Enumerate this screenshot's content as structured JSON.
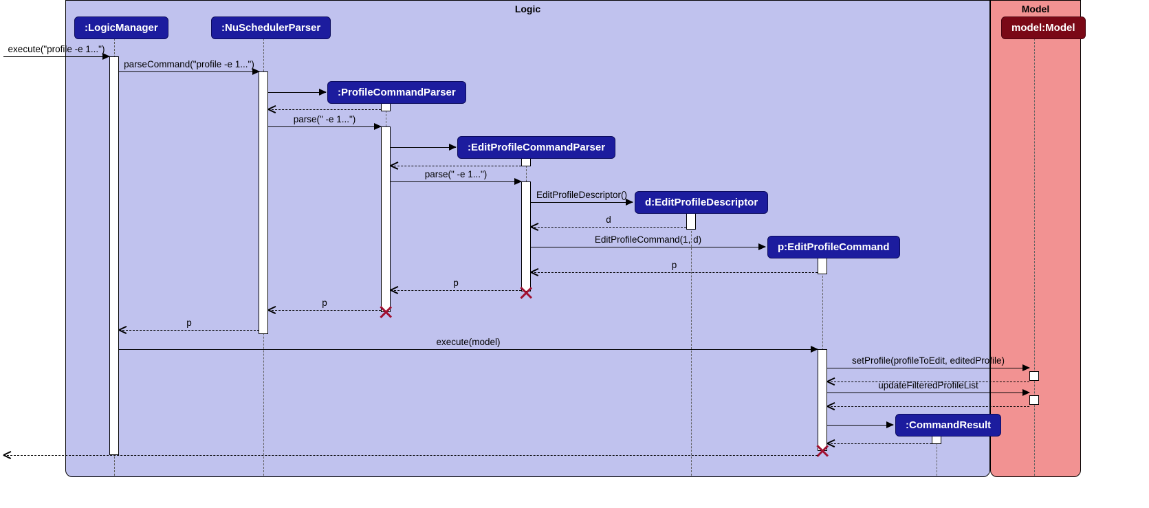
{
  "frames": {
    "logic": "Logic",
    "model": "Model"
  },
  "lifelines": {
    "logicManager": ":LogicManager",
    "nuSchedulerParser": ":NuSchedulerParser",
    "profileCommandParser": ":ProfileCommandParser",
    "editProfileCommandParser": ":EditProfileCommandParser",
    "editProfileDescriptor": "d:EditProfileDescriptor",
    "editProfileCommand": "p:EditProfileCommand",
    "commandResult": ":CommandResult",
    "modelObj": "model:Model"
  },
  "messages": {
    "m1": "execute(\"profile -e 1...\")",
    "m2": "parseCommand(\"profile -e 1...\")",
    "m3_return": "",
    "m4": "parse(\" -e 1...\")",
    "m5_return": "",
    "m6": "parse(\" -e 1...\")",
    "m7": "EditProfileDescriptor()",
    "m8": "d",
    "m9": "EditProfileCommand(1, d)",
    "m10": "p",
    "m11": "p",
    "m12": "p",
    "m13": "p",
    "m14": "execute(model)",
    "m15": "setProfile(profileToEdit, editedProfile)",
    "m16_return": "",
    "m17": "updateFilteredProfileList",
    "m18_return": "",
    "m19_return": "",
    "m20_return": ""
  }
}
